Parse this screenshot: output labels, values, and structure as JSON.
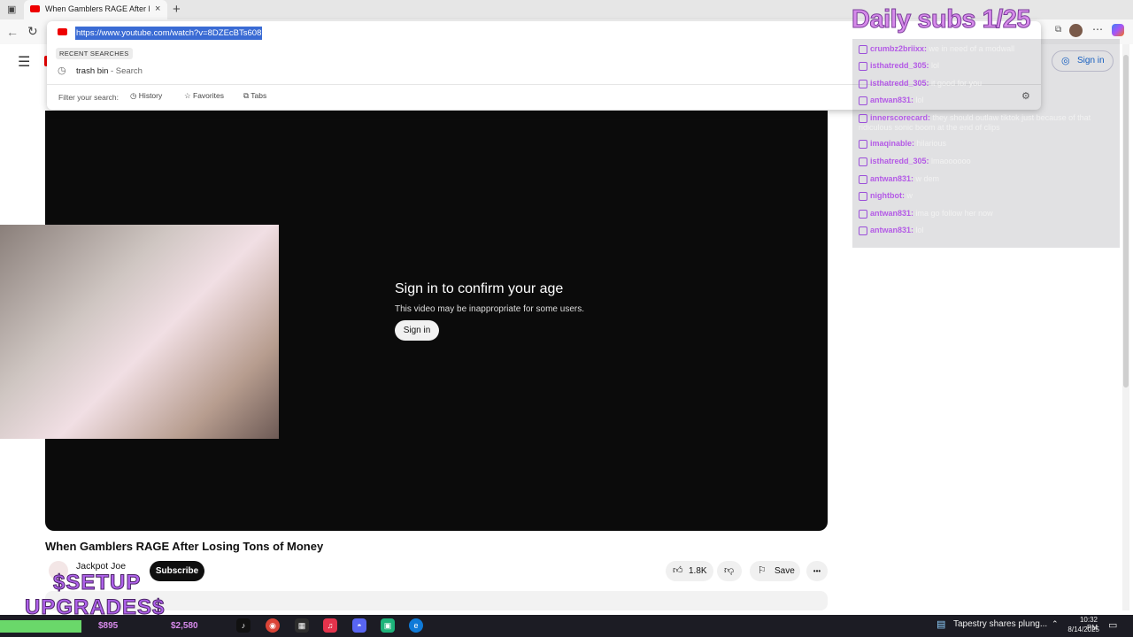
{
  "browser": {
    "tab_title": "When Gamblers RAGE After Losing Tons of Money",
    "tab_close": "×",
    "new_tab": "+",
    "url": "https://www.youtube.com/watch?v=8DZEcBTs608"
  },
  "omnibox": {
    "recent_heading": "RECENT SEARCHES",
    "suggestion_term": "trash bin",
    "suggestion_source": "- Search",
    "filter_label": "Filter your search:",
    "filters": [
      "History",
      "Favorites",
      "Tabs"
    ]
  },
  "youtube": {
    "signin_label": "Sign in",
    "age_title": "Sign in to confirm your age",
    "age_subtitle": "This video may be inappropriate for some users.",
    "age_signin": "Sign in",
    "video_title": "When Gamblers RAGE After Losing Tons of Money",
    "channel_name": "Jackpot Joe",
    "subscribe": "Subscribe",
    "likes": "1.8K",
    "save": "Save",
    "more": "•••"
  },
  "overlays": {
    "daily_subs": "Daily subs 1/25",
    "setup_line1": "$SETUP",
    "setup_line2": "UPGRADES$",
    "prices": [
      "$895",
      "$2,580"
    ],
    "chat": [
      {
        "name": "crumbz2briixx:",
        "msg": "we in need of a modwall"
      },
      {
        "name": "isthatredd_305:",
        "msg": "lol"
      },
      {
        "name": "isthatredd_305:",
        "msg": "it good for you"
      },
      {
        "name": "antwan831:",
        "msg": "lol"
      },
      {
        "name": "innerscorecard:",
        "msg": "they should outlaw tiktok just because of that ridiculous sonic boom at the end of clips"
      },
      {
        "name": "imaqinable:",
        "msg": "hilarious"
      },
      {
        "name": "isthatredd_305:",
        "msg": "lmaoooooo"
      },
      {
        "name": "antwan831:",
        "msg": "w dem"
      },
      {
        "name": "nightbot:",
        "msg": "w"
      },
      {
        "name": "antwan831:",
        "msg": "ima go follow her now"
      },
      {
        "name": "antwan831:",
        "msg": "lol"
      }
    ]
  },
  "taskbar": {
    "news": "Tapestry shares plung...",
    "time": "10:32 PM",
    "date": "8/14/2025"
  },
  "colors": {
    "overlay_purple": "#d68aea",
    "player_bg": "#0b0b0b",
    "url_highlight": "#3a6bd4"
  }
}
